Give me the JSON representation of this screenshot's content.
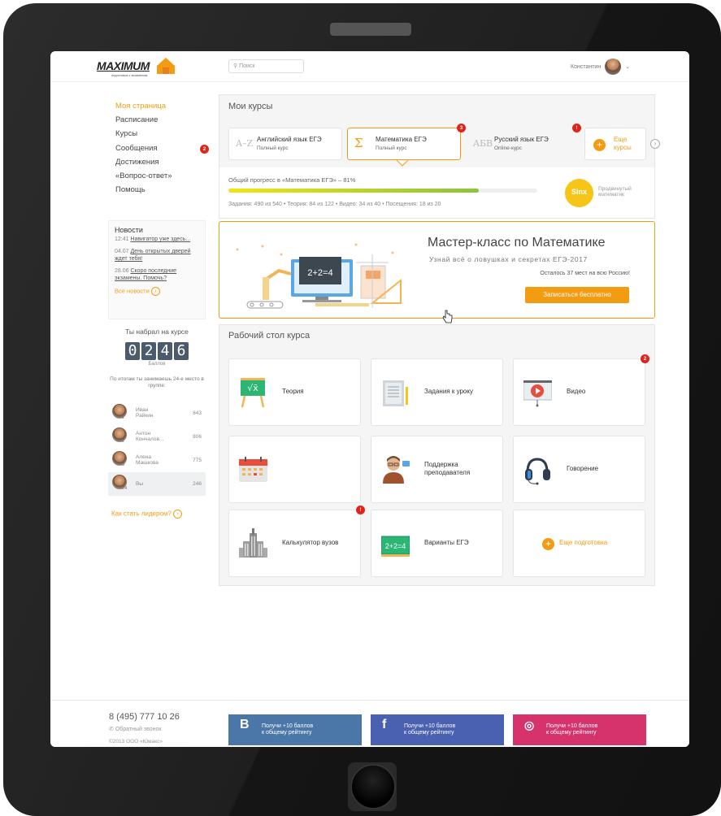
{
  "header": {
    "logo_text": "MAXIMUM",
    "logo_sub": "подготовка к экзаменам",
    "search_placeholder": "Поиск",
    "user_name": "Константин"
  },
  "sidebar": {
    "items": [
      {
        "label": "Моя страница",
        "active": true
      },
      {
        "label": "Расписание"
      },
      {
        "label": "Курсы"
      },
      {
        "label": "Сообщения",
        "badge": "2"
      },
      {
        "label": "Достижения"
      },
      {
        "label": "«Вопрос-ответ»"
      },
      {
        "label": "Помощь"
      }
    ]
  },
  "news": {
    "title": "Новости",
    "items": [
      {
        "time": "12:41",
        "text": "Навигатор уже здесь..."
      },
      {
        "time": "04.07",
        "text": "День открытых дверей ждет тебя!"
      },
      {
        "time": "28.06",
        "text": "Скоро последние экзамены. Помочь?"
      }
    ],
    "all_link": "Все новости"
  },
  "score": {
    "label": "Ты набрал на курсе",
    "digits": [
      "0",
      "2",
      "4",
      "6"
    ],
    "unit": "Баллов",
    "rank_text": "По итогам ты занимаешь 24-е место в группе:"
  },
  "leaderboard": [
    {
      "first": "Иван",
      "last": "Райкин",
      "pos": "1",
      "score": "843"
    },
    {
      "first": "Антон",
      "last": "Кончалов...",
      "pos": "2",
      "score": "806"
    },
    {
      "first": "Алена",
      "last": "Машкова",
      "pos": "3",
      "score": "775"
    },
    {
      "first": "Вы",
      "last": "",
      "pos": "24",
      "score": "246"
    }
  ],
  "leader_link": "Как стать лидером?",
  "courses": {
    "title": "Мои курсы",
    "tabs": [
      {
        "icon": "A–Z",
        "name": "Английский язык ЕГЭ",
        "sub": "Полный курс"
      },
      {
        "icon": "Σ",
        "name": "Математика ЕГЭ",
        "sub": "Полный курс",
        "badge": "3",
        "selected": true
      },
      {
        "icon": "AБB",
        "name": "Русский язык ЕГЭ",
        "sub": "Online-курс",
        "badge": "!"
      }
    ],
    "more_label": "Еще курсы",
    "more_line1": "Еще",
    "more_line2": "курсы"
  },
  "progress": {
    "label": "Общий прогресс в «Математика ЕГЭ» – 81%",
    "percent": 81,
    "stats": "Задания: 490 из 540  •  Теория: 84 из 122  •  Видео: 34 из 40  •  Посещения: 18 из 20",
    "badge_text": "Sinx",
    "level_line1": "Продвинутый",
    "level_line2": "математик"
  },
  "banner": {
    "title": "Мастер-класс по Математике",
    "subtitle": "Узнай всё о ловушках и секретах ЕГЭ-2017",
    "spots": "Осталось 37 мест на всю Россию!",
    "button": "Записаться бесплатно",
    "board_text": "2+2=4"
  },
  "desk": {
    "title": "Рабочий стол курса",
    "tiles": [
      {
        "label": "Теория",
        "icon": "blackboard-icon"
      },
      {
        "label": "Задания к уроку",
        "icon": "document-icon"
      },
      {
        "label": "Видео",
        "icon": "video-icon",
        "badge": "2"
      },
      {
        "label": "",
        "icon": "calendar-icon"
      },
      {
        "label": "Поддержка преподавателя",
        "icon": "teacher-icon"
      },
      {
        "label": "Говорение",
        "icon": "headphones-icon"
      },
      {
        "label": "Калькулятор вузов",
        "icon": "university-icon",
        "badge": "!"
      },
      {
        "label": "Варианты ЕГЭ",
        "icon": "chalkboard-icon",
        "board": "2+2=4"
      },
      {
        "label": "Еще подготовка",
        "icon": "plus-icon"
      }
    ]
  },
  "footer": {
    "phone": "8 (495) 777 10 26",
    "callback": "Обратный звонок",
    "copyright": "©2013 ООО «Юмакс»",
    "social": [
      {
        "glyph": "B",
        "line1": "Получи +10 баллов",
        "line2": "к общему рейтингу",
        "color": "#4a76a8"
      },
      {
        "glyph": "f",
        "line1": "Получи +10 баллов",
        "line2": "к общему рейтингу",
        "color": "#4a60b0"
      },
      {
        "glyph": "◎",
        "line1": "Получи +10 баллов",
        "line2": "к общему рейтингу",
        "color": "#d6336c"
      }
    ]
  },
  "colors": {
    "accent": "#f39c12",
    "badge": "#e2231a"
  }
}
